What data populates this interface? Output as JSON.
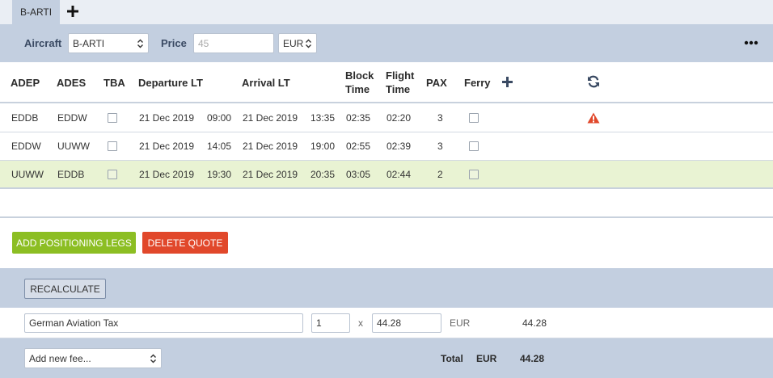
{
  "tabs": [
    {
      "label": "B-ARTI",
      "active": true
    }
  ],
  "toolbar": {
    "aircraft_label": "Aircraft",
    "aircraft_value": "B-ARTI",
    "price_label": "Price",
    "price_placeholder": "45",
    "currency_value": "EUR"
  },
  "table": {
    "headers": {
      "adep": "ADEP",
      "ades": "ADES",
      "tba": "TBA",
      "departure": "Departure LT",
      "arrival": "Arrival LT",
      "block_time_1": "Block",
      "block_time_2": "Time",
      "flight_time_1": "Flight",
      "flight_time_2": "Time",
      "pax": "PAX",
      "ferry": "Ferry"
    },
    "rows": [
      {
        "adep": "EDDB",
        "ades": "EDDW",
        "tba": false,
        "dep_date": "21 Dec 2019",
        "dep_time": "09:00",
        "arr_date": "21 Dec 2019",
        "arr_time": "13:35",
        "block": "02:35",
        "flight": "02:20",
        "pax": "3",
        "ferry": false,
        "warning": true,
        "selected": false
      },
      {
        "adep": "EDDW",
        "ades": "UUWW",
        "tba": false,
        "dep_date": "21 Dec 2019",
        "dep_time": "14:05",
        "arr_date": "21 Dec 2019",
        "arr_time": "19:00",
        "block": "02:55",
        "flight": "02:39",
        "pax": "3",
        "ferry": false,
        "warning": false,
        "selected": false
      },
      {
        "adep": "UUWW",
        "ades": "EDDB",
        "tba": false,
        "dep_date": "21 Dec 2019",
        "dep_time": "19:30",
        "arr_date": "21 Dec 2019",
        "arr_time": "20:35",
        "block": "03:05",
        "flight": "02:44",
        "pax": "2",
        "ferry": false,
        "warning": false,
        "selected": true
      }
    ]
  },
  "actions": {
    "add_positioning": "ADD POSITIONING LEGS",
    "delete_quote": "DELETE QUOTE",
    "recalculate": "RECALCULATE"
  },
  "fees": [
    {
      "name": "German Aviation Tax",
      "quantity": "1",
      "multiplier": "x",
      "unit_price": "44.28",
      "currency": "EUR",
      "amount": "44.28"
    }
  ],
  "footer": {
    "add_fee_placeholder": "Add new fee...",
    "total_label": "Total",
    "total_currency": "EUR",
    "total_value": "44.28"
  },
  "colors": {
    "header_bar": "#c3cfe0",
    "selected_row": "#e9f3d3",
    "green_button": "#8cbe23",
    "red_button": "#e1482b",
    "warning": "#e1482b",
    "icon_blue": "#3a4a63"
  },
  "icons": {
    "add_tab": "plus-icon",
    "more": "ellipsis-icon",
    "add_column": "plus-icon",
    "refresh": "refresh-icon",
    "warning": "warning-triangle-icon",
    "select_chevron": "chevron-updown-icon"
  }
}
